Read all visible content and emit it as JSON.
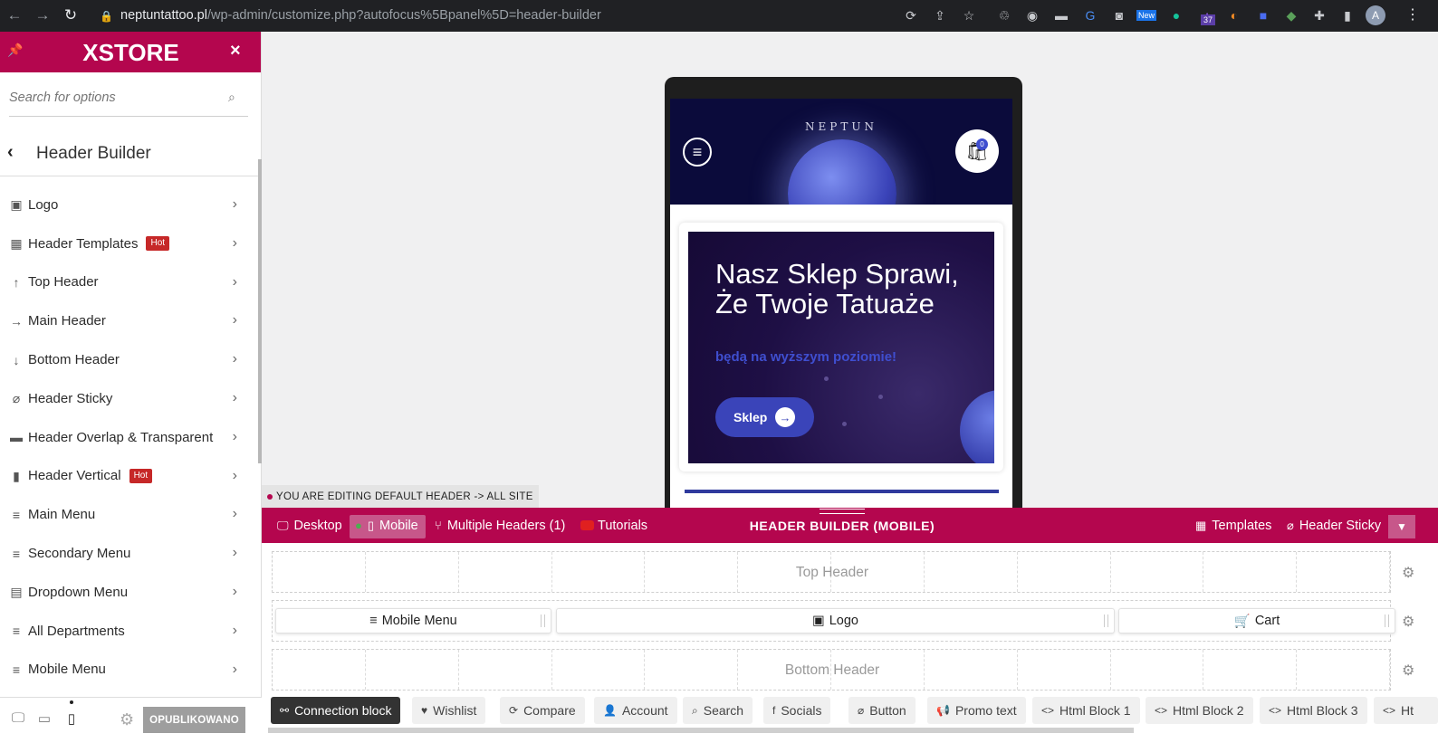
{
  "browser": {
    "url_host": "neptuntattoo.pl",
    "url_path": "/wp-admin/customize.php?autofocus%5Bpanel%5D=header-builder",
    "ext_badge_new": "New",
    "ext_badge_count": "37",
    "avatar_letter": "A"
  },
  "sidebar": {
    "brand": "XSTORE",
    "search_placeholder": "Search for options",
    "panel_title": "Header Builder",
    "items": [
      {
        "label": "Logo",
        "icon": "image-icon",
        "badge": ""
      },
      {
        "label": "Header Templates",
        "icon": "templates-icon",
        "badge": "Hot"
      },
      {
        "label": "Top Header",
        "icon": "arrow-up-icon",
        "badge": ""
      },
      {
        "label": "Main Header",
        "icon": "arrow-right-icon",
        "badge": ""
      },
      {
        "label": "Bottom Header",
        "icon": "arrow-down-icon",
        "badge": ""
      },
      {
        "label": "Header Sticky",
        "icon": "paperclip-icon",
        "badge": ""
      },
      {
        "label": "Header Overlap & Transparent",
        "icon": "overlap-icon",
        "badge": ""
      },
      {
        "label": "Header Vertical",
        "icon": "vertical-icon",
        "badge": "Hot"
      },
      {
        "label": "Main Menu",
        "icon": "menu-icon",
        "badge": ""
      },
      {
        "label": "Secondary Menu",
        "icon": "menu-icon",
        "badge": ""
      },
      {
        "label": "Dropdown Menu",
        "icon": "dropdown-icon",
        "badge": ""
      },
      {
        "label": "All Departments",
        "icon": "menu-icon",
        "badge": ""
      },
      {
        "label": "Mobile Menu",
        "icon": "menu-icon",
        "badge": ""
      }
    ],
    "publish_label": "OPUBLIKOWANO"
  },
  "preview": {
    "site_name": "NEPTUN",
    "cart_count": "0",
    "banner_title": "Nasz Sklep Sprawi, Że Twoje Tatuaże",
    "banner_subtitle": "będą na wyższym poziomie!",
    "banner_button": "Sklep"
  },
  "notice": "YOU ARE EDITING DEFAULT HEADER -> ALL SITE",
  "header_builder": {
    "tabs": {
      "desktop": "Desktop",
      "mobile": "Mobile",
      "multiple": "Multiple Headers (1)",
      "tutorials": "Tutorials"
    },
    "title": "HEADER BUILDER (MOBILE)",
    "templates": "Templates",
    "sticky": "Header Sticky",
    "rows": {
      "top": "Top Header",
      "bottom": "Bottom Header"
    },
    "main_blocks": {
      "mobile_menu": "Mobile Menu",
      "logo": "Logo",
      "cart": "Cart"
    },
    "elements": [
      {
        "label": "Connection block",
        "icon": "connection-icon"
      },
      {
        "label": "Wishlist",
        "icon": "heart-icon"
      },
      {
        "label": "Compare",
        "icon": "compare-icon"
      },
      {
        "label": "Account",
        "icon": "user-icon"
      },
      {
        "label": "Search",
        "icon": "search-icon"
      },
      {
        "label": "Socials",
        "icon": "facebook-icon"
      },
      {
        "label": "Button",
        "icon": "link-icon"
      },
      {
        "label": "Promo text",
        "icon": "megaphone-icon"
      },
      {
        "label": "Html Block 1",
        "icon": "code-icon"
      },
      {
        "label": "Html Block 2",
        "icon": "code-icon"
      },
      {
        "label": "Html Block 3",
        "icon": "code-icon"
      },
      {
        "label": "Ht",
        "icon": "code-icon"
      }
    ]
  },
  "colors": {
    "brand": "#b4064e",
    "hot_badge": "#c62828",
    "preview_blue": "#3a44b9"
  }
}
